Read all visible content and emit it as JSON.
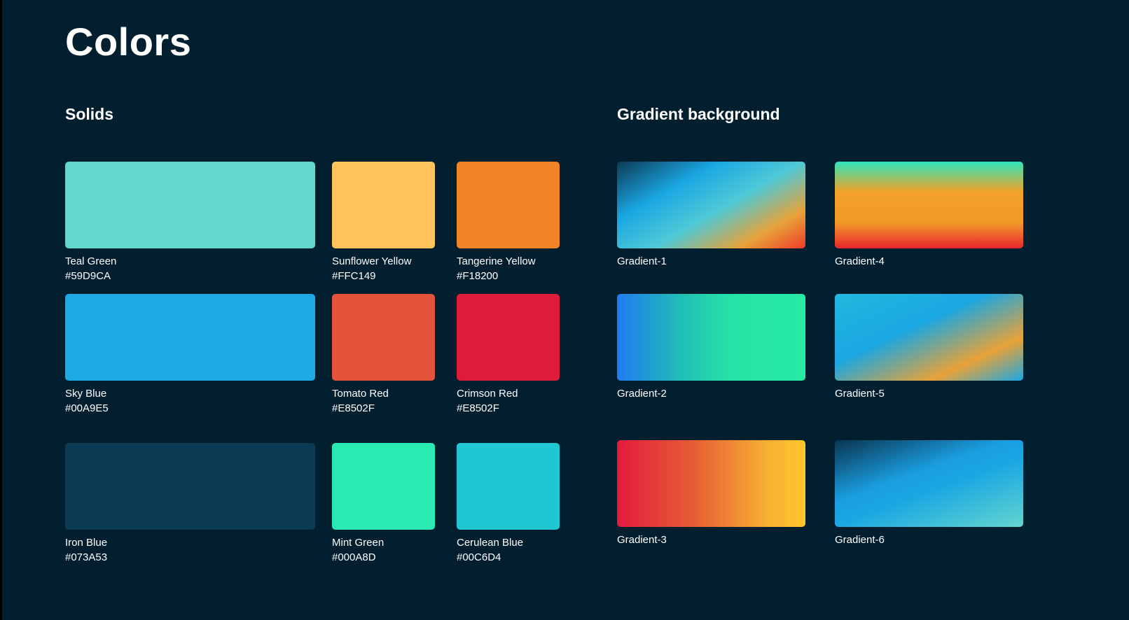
{
  "title": "Colors",
  "solids": {
    "heading": "Solids",
    "items": [
      {
        "name": "Teal Green",
        "hex": "#59D9CA",
        "color": "#62D8CC"
      },
      {
        "name": "Sunflower Yellow",
        "hex": "#FFC149",
        "color": "#FEC35A"
      },
      {
        "name": "Tangerine Yellow",
        "hex": "#F18200",
        "color": "#F08426"
      },
      {
        "name": "Sky Blue",
        "hex": "#00A9E5",
        "color": "#1DA9E2"
      },
      {
        "name": "Tomato Red",
        "hex": "#E8502F",
        "color": "#E6533B"
      },
      {
        "name": "Crimson Red",
        "hex": "#E8502F",
        "color": "#DD1C3B"
      },
      {
        "name": "Iron Blue",
        "hex": "#073A53",
        "color": "#0B3A55"
      },
      {
        "name": "Mint Green",
        "hex": "#000A8D",
        "color": "#28EAB2"
      },
      {
        "name": "Cerulean Blue",
        "hex": "#00C6D4",
        "color": "#20C6D2"
      }
    ]
  },
  "gradients": {
    "heading": "Gradient background",
    "items": [
      {
        "name": "Gradient-1"
      },
      {
        "name": "Gradient-4"
      },
      {
        "name": "Gradient-2"
      },
      {
        "name": "Gradient-5"
      },
      {
        "name": "Gradient-3"
      },
      {
        "name": "Gradient-6"
      }
    ]
  }
}
